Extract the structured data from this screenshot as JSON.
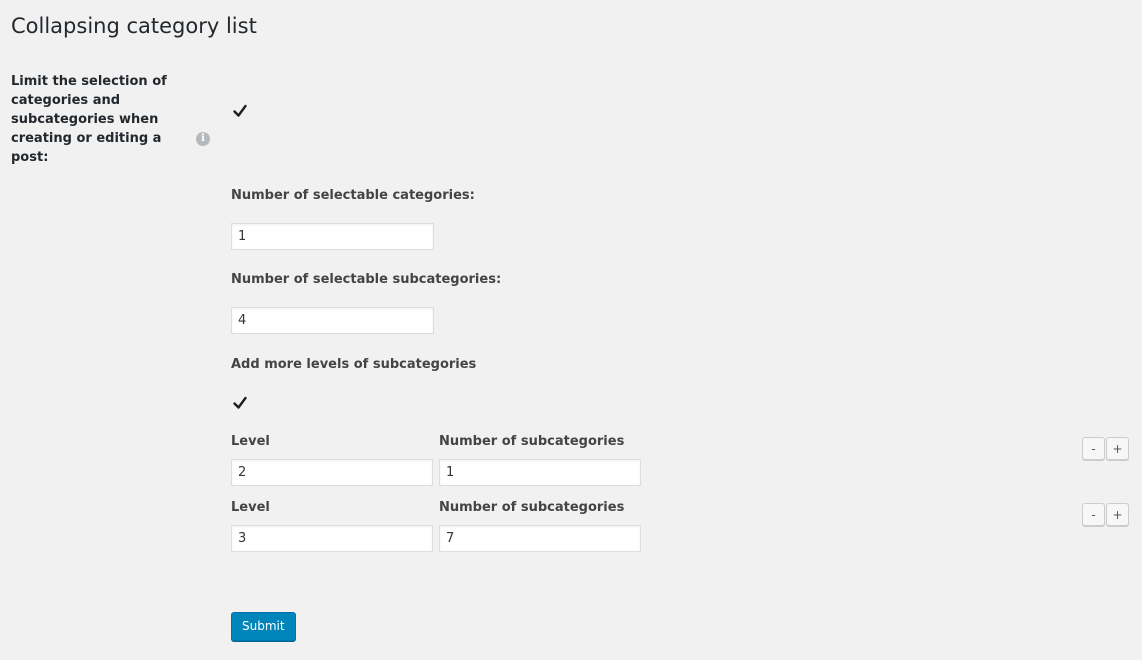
{
  "page": {
    "title": "Collapsing category list"
  },
  "limit_selection": {
    "label": "Limit the selection of categories and subcategories when creating or editing a post:",
    "checked": true,
    "info_icon": "info-icon",
    "info_glyph": "i"
  },
  "categories": {
    "label": "Number of selectable categories:",
    "value": "1"
  },
  "subcategories": {
    "label": "Number of selectable subcategories:",
    "value": "4"
  },
  "more_levels": {
    "label": "Add more levels of subcategories",
    "checked": true
  },
  "levels": [
    {
      "level_label": "Level",
      "level_value": "2",
      "count_label": "Number of subcategories",
      "count_value": "1",
      "minus_label": "-",
      "plus_label": "+"
    },
    {
      "level_label": "Level",
      "level_value": "3",
      "count_label": "Number of subcategories",
      "count_value": "7",
      "minus_label": "-",
      "plus_label": "+"
    }
  ],
  "submit": {
    "label": "Submit"
  },
  "colors": {
    "background": "#f1f1f1",
    "primary_button": "#0085ba",
    "text": "#23282d"
  }
}
